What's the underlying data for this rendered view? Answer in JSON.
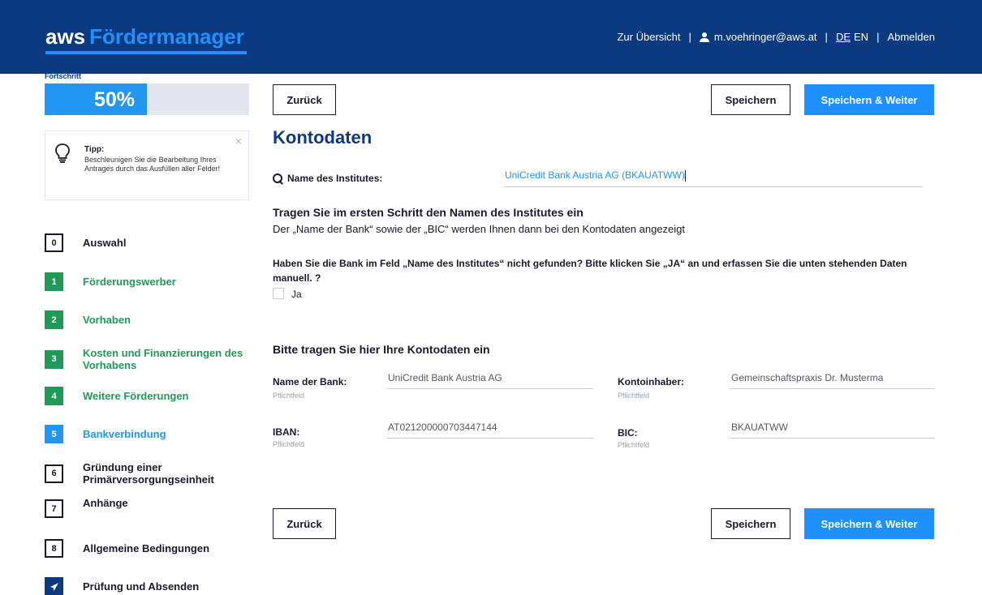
{
  "header": {
    "brand": "aws",
    "product": "Fördermanager",
    "nav_overview": "Zur Übersicht",
    "separator": "|",
    "user_email": "m.voehringer@aws.at",
    "lang_de": "DE",
    "lang_en": "EN",
    "logout": "Abmelden"
  },
  "progress": {
    "label": "Fortschritt",
    "text": "50%",
    "value": 0.5
  },
  "tip": {
    "title": "Tipp:",
    "text": "Beschleunigen Sie die Bearbeitung Ihres Antrages durch das Ausfüllen aller Felder!",
    "close": "×"
  },
  "steps": [
    {
      "num": "0",
      "label": "Auswahl",
      "state": "open"
    },
    {
      "num": "1",
      "label": "Förderungswerber",
      "state": "done"
    },
    {
      "num": "2",
      "label": "Vorhaben",
      "state": "done"
    },
    {
      "num": "3",
      "label": "Kosten und Finanzierungen des Vorhabens",
      "state": "done"
    },
    {
      "num": "4",
      "label": "Weitere Förderungen",
      "state": "done"
    },
    {
      "num": "5",
      "label": "Bankverbindung",
      "state": "active"
    },
    {
      "num": "6",
      "label": "Gründung einer Primärversorgungseinheit",
      "state": "open"
    },
    {
      "num": "7",
      "label": "Anhänge",
      "state": "open"
    },
    {
      "num": "8",
      "label": "Allgemeine Bedingungen",
      "state": "open"
    },
    {
      "num": "",
      "label": "Prüfung und Absenden",
      "state": "send"
    }
  ],
  "buttons": {
    "back": "Zurück",
    "save": "Speichern",
    "save_next": "Speichern & Weiter"
  },
  "main": {
    "title": "Kontodaten",
    "search_label": "Name des Institutes:",
    "search_value": "UniCredit Bank Austria AG (BKAUATWW)",
    "heading1": "Tragen Sie im ersten Schritt den Namen des Institutes ein",
    "sub1": "Der „Name der Bank“ sowie der „BIC“ werden Ihnen dann bei den Kontodaten angezeigt",
    "question": "Haben Sie die Bank im Feld „Name des Institutes“ nicht gefunden? Bitte klicken Sie „JA“ an und erfassen Sie die unten stehenden Daten manuell. ?",
    "checkbox_label": "Ja",
    "heading2": "Bitte tragen Sie hier Ihre Kontodaten ein"
  },
  "fields": {
    "bank_name": {
      "label": "Name der Bank:",
      "hint": "Pflichtfeld",
      "value": "UniCredit Bank Austria AG"
    },
    "holder": {
      "label": "Kontoinhaber:",
      "hint": "Pflichtfeld",
      "value": "Gemeinschaftspraxis Dr. Musterma"
    },
    "iban": {
      "label": "IBAN:",
      "hint": "Pflichtfeld",
      "value": "AT021200000703447144"
    },
    "bic": {
      "label": "BIC:",
      "hint": "Pflichtfeld",
      "value": "BKAUATWW"
    }
  },
  "colors": {
    "header_bg": "#0c3a80",
    "accent_blue": "#1e90ff",
    "done_green": "#1e9b57"
  }
}
